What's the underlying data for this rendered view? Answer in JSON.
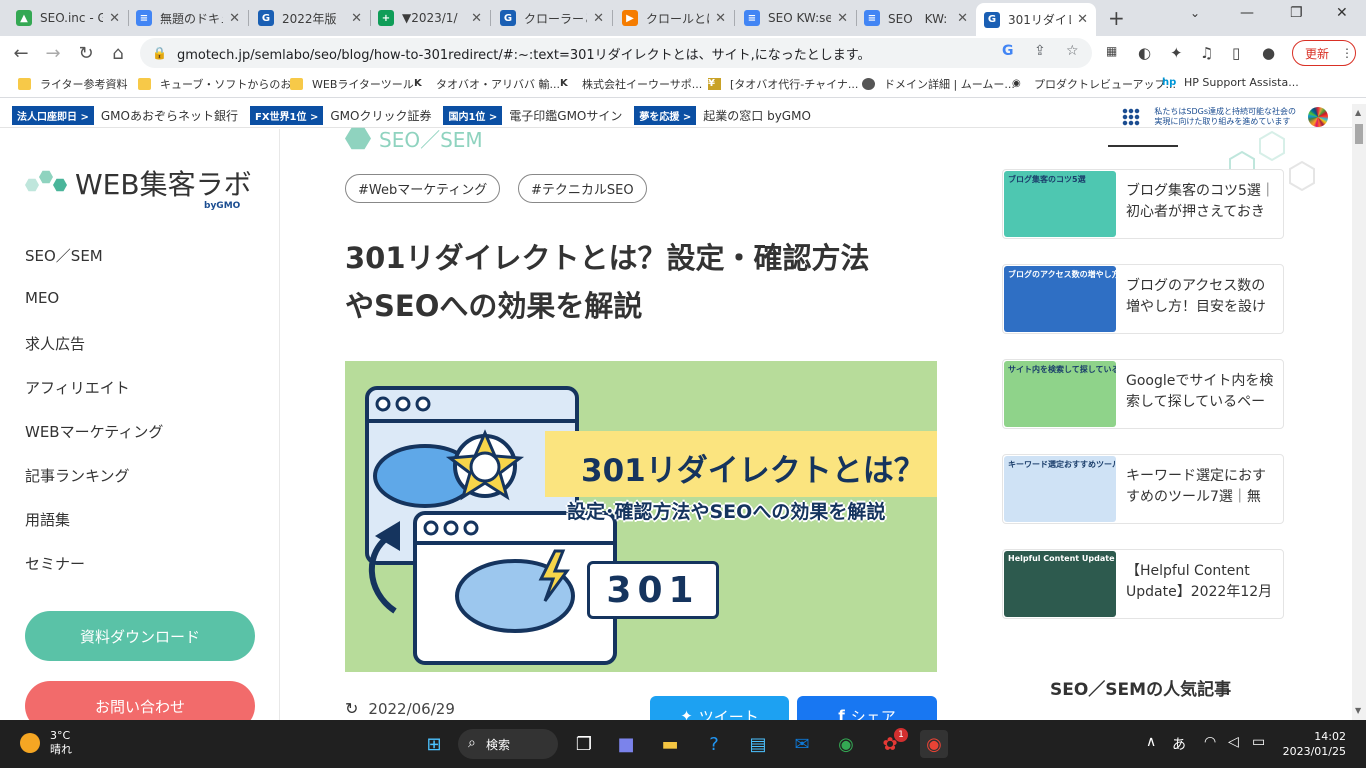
{
  "browser": {
    "tabs": [
      {
        "title": "SEO.inc - G",
        "color": "#34a853",
        "glyph": "▲"
      },
      {
        "title": "無題のドキュ",
        "color": "#4285f4",
        "glyph": "≡"
      },
      {
        "title": "2022年版",
        "color": "#1a5fb4",
        "glyph": "G"
      },
      {
        "title": "▼2023/1/",
        "color": "#0f9d58",
        "glyph": "+"
      },
      {
        "title": "クローラーとは",
        "color": "#1a5fb4",
        "glyph": "G"
      },
      {
        "title": "クロールとは",
        "color": "#f57c00",
        "glyph": "▶"
      },
      {
        "title": "SEO KW:se",
        "color": "#4285f4",
        "glyph": "≡"
      },
      {
        "title": "SEO　KW:",
        "color": "#4285f4",
        "glyph": "≡"
      },
      {
        "title": "301リダイレ",
        "color": "#1a5fb4",
        "glyph": "G"
      }
    ],
    "url": "gmotech.jp/semlabo/seo/blog/how-to-301redirect/#:~:text=301リダイレクトとは、サイト,になったとします。",
    "update_label": "更新",
    "bookmarks": [
      {
        "label": "ライター参考資料",
        "kind": "folder"
      },
      {
        "label": "キューブ・ソフトからのお...",
        "kind": "folder"
      },
      {
        "label": "WEBライターツール",
        "kind": "folder"
      },
      {
        "label": "タオバオ・アリババ 輸...",
        "kind": "k"
      },
      {
        "label": "株式会社イーウーサポ...",
        "kind": "k"
      },
      {
        "label": "[タオバオ代行-チャイナ...",
        "kind": "y"
      },
      {
        "label": "ドメイン詳細 | ムームー...",
        "kind": "apple"
      },
      {
        "label": "プロダクトレビューアップ...",
        "kind": "globe"
      },
      {
        "label": "HP Support Assista...",
        "kind": "hp"
      }
    ]
  },
  "gmo_bar": {
    "items": [
      {
        "tag": "法人口座即日 >",
        "text": "GMOあおぞらネット銀行"
      },
      {
        "tag": "FX世界1位 >",
        "text": "GMOクリック証券"
      },
      {
        "tag": "国内1位 >",
        "text": "電子印鑑GMOサイン"
      },
      {
        "tag": "夢を応援 >",
        "text": "起業の窓口 byGMO"
      }
    ],
    "sdgs_line1": "私たちはSDGs達成と持続可能な社会の",
    "sdgs_line2": "実現に向けた取り組みを進めています"
  },
  "sidebar": {
    "logo_text": "WEB集客ラボ",
    "logo_by": "byGMO",
    "nav": [
      "SEO／SEM",
      "MEO",
      "求人広告",
      "アフィリエイト",
      "WEBマーケティング",
      "記事ランキング",
      "用語集",
      "セミナー"
    ],
    "download_label": "資料ダウンロード",
    "contact_label": "お問い合わせ"
  },
  "article": {
    "category": "SEO／SEM",
    "tags": [
      "#Webマーケティング",
      "#テクニカルSEO"
    ],
    "title_line1": "301リダイレクトとは？設定・確認方法",
    "title_line2": "やSEOへの効果を解説",
    "hero_title": "301リダイレクトとは？",
    "hero_subtitle": "設定･確認方法やSEOへの効果を解説",
    "hero_number": "301",
    "date": "2022/06/29",
    "tweet_label": "ツイート",
    "share_label": "シェア"
  },
  "related": [
    {
      "title": "ブログ集客のコツ5選｜初心者が押さえておき",
      "thumb_text": "ブログ集客のコツ5選",
      "bg": "#4ec7b1",
      "fg": "#1b3e6b"
    },
    {
      "title": "ブログのアクセス数の増やし方！目安を設け",
      "thumb_text": "ブログのアクセス数の増やし方",
      "bg": "#2f6fc4",
      "fg": "#ffffff"
    },
    {
      "title": "Googleでサイト内を検索して探しているペー",
      "thumb_text": "サイト内を検索して探しているページ",
      "bg": "#8fd38a",
      "fg": "#1b3e6b"
    },
    {
      "title": "キーワード選定におすすめのツール7選｜無",
      "thumb_text": "キーワード選定おすすめツール7選",
      "bg": "#cfe2f5",
      "fg": "#1b3e6b"
    },
    {
      "title": "【Helpful Content Update】2022年12月",
      "thumb_text": "Helpful Content Update",
      "bg": "#2d5a4e",
      "fg": "#ffffff"
    }
  ],
  "popular_heading": "SEO／SEMの人気記事",
  "taskbar": {
    "temp": "3°C",
    "weather": "晴れ",
    "search_label": "検索",
    "notification_count": "1",
    "ime": "あ",
    "time": "14:02",
    "date": "2023/01/25"
  }
}
